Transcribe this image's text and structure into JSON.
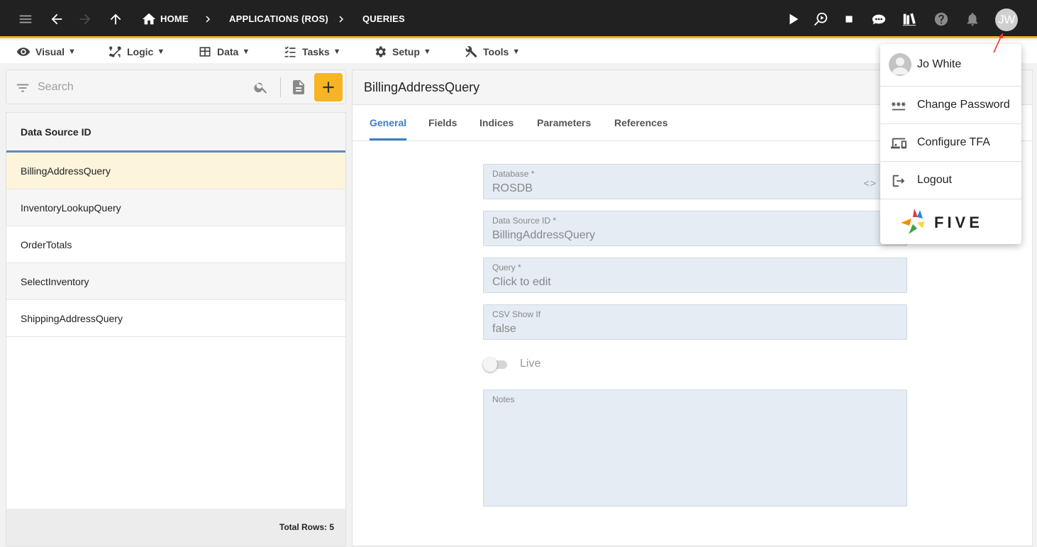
{
  "topbar": {
    "breadcrumbs": [
      "HOME",
      "APPLICATIONS (ROS)",
      "QUERIES"
    ],
    "avatar_initials": "JW",
    "accent_color": "#f5b31a"
  },
  "menubar": {
    "items": [
      {
        "label": "Visual",
        "icon": "eye-icon"
      },
      {
        "label": "Logic",
        "icon": "flow-icon"
      },
      {
        "label": "Data",
        "icon": "table-icon"
      },
      {
        "label": "Tasks",
        "icon": "checklist-icon"
      },
      {
        "label": "Setup",
        "icon": "gear-icon"
      },
      {
        "label": "Tools",
        "icon": "tools-icon"
      }
    ],
    "caret": "▼"
  },
  "search": {
    "placeholder": "Search"
  },
  "list": {
    "header": "Data Source ID",
    "rows": [
      "BillingAddressQuery",
      "InventoryLookupQuery",
      "OrderTotals",
      "SelectInventory",
      "ShippingAddressQuery"
    ],
    "selected_index": 0,
    "footer": "Total Rows: 5"
  },
  "form": {
    "title": "BillingAddressQuery",
    "tabs": [
      "General",
      "Fields",
      "Indices",
      "Parameters",
      "References"
    ],
    "active_tab": 0,
    "fields": {
      "database": {
        "label": "Database *",
        "value": "ROSDB",
        "code_glyph": "<>"
      },
      "data_source_id": {
        "label": "Data Source ID *",
        "value": "BillingAddressQuery"
      },
      "query": {
        "label": "Query *",
        "value": "Click to edit"
      },
      "csv_show_if": {
        "label": "CSV Show If",
        "value": "false"
      },
      "notes": {
        "label": "Notes",
        "value": ""
      }
    },
    "live_toggle": {
      "label": "Live",
      "on": false
    }
  },
  "user_menu": {
    "name": "Jo White",
    "items": [
      {
        "label": "Change Password",
        "icon": "password-icon"
      },
      {
        "label": "Configure TFA",
        "icon": "devices-icon"
      },
      {
        "label": "Logout",
        "icon": "logout-icon"
      }
    ],
    "logo_text": "FIVE"
  },
  "colors": {
    "primary_blue": "#3d7fc3",
    "add_button": "#f7b526",
    "selected_row": "#fdf4dc",
    "field_bg": "#e5ecf4"
  }
}
